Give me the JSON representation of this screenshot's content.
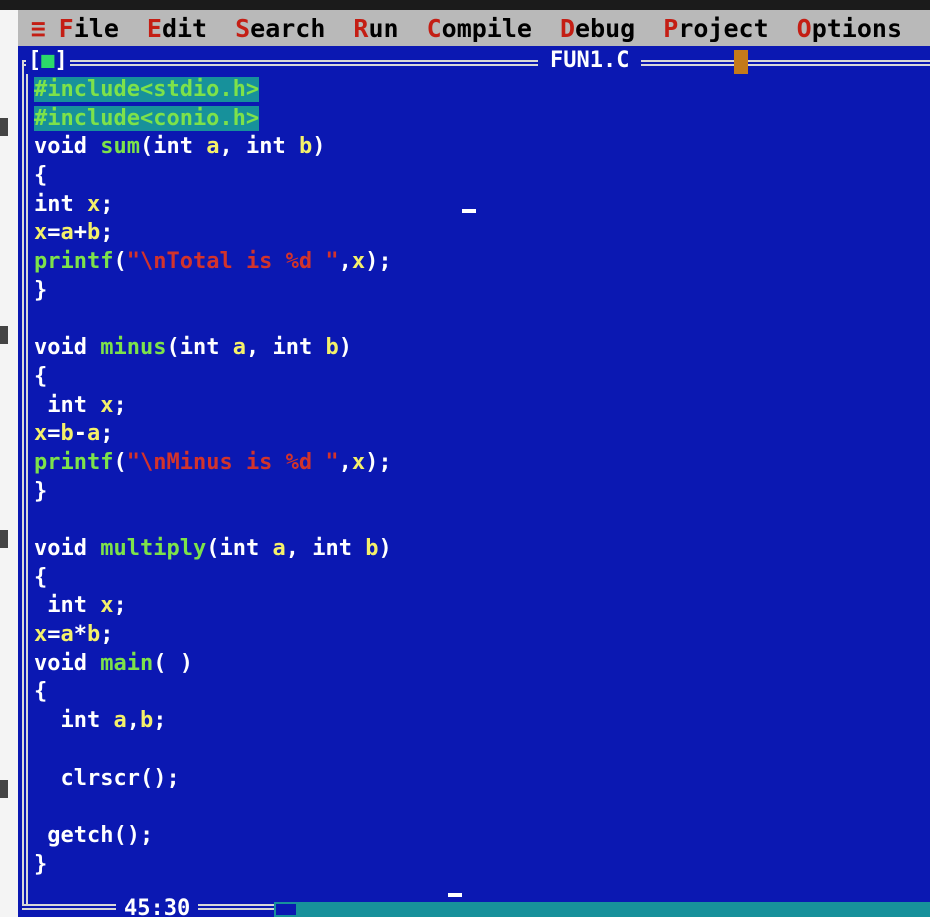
{
  "menu": {
    "system": "≡",
    "items": [
      {
        "hot": "F",
        "rest": "ile"
      },
      {
        "hot": "E",
        "rest": "dit"
      },
      {
        "hot": "S",
        "rest": "earch"
      },
      {
        "hot": "R",
        "rest": "un"
      },
      {
        "hot": "C",
        "rest": "ompile"
      },
      {
        "hot": "D",
        "rest": "ebug"
      },
      {
        "hot": "P",
        "rest": "roject"
      },
      {
        "hot": "O",
        "rest": "ptions"
      }
    ]
  },
  "window": {
    "close_box_left": "[",
    "close_box_mark": "■",
    "close_box_right": "]",
    "title": "FUN1.C"
  },
  "status": {
    "position": "45:30"
  },
  "code_lines": [
    "#include<stdio.h>",
    "#include<conio.h>",
    "void sum(int a, int b)",
    "{",
    "int x;",
    "x=a+b;",
    "printf(\"\\nTotal is %d \",x);",
    "}",
    "",
    "void minus(int a, int b)",
    "{",
    " int x;",
    "x=b-a;",
    "printf(\"\\nMinus is %d \",x);",
    "}",
    "",
    "void multiply(int a, int b)",
    "{",
    " int x;",
    "x=a*b;",
    "void main( )",
    "{",
    "  int a,b;",
    "",
    "  clrscr();",
    "",
    " getch();",
    "}"
  ],
  "colors": {
    "editor_bg": "#0b18b2",
    "menubar_bg": "#b9b9b9",
    "hotkey": "#c41e14",
    "keyword": "#ffffff",
    "identifier": "#f4f06a",
    "function": "#7de24a",
    "string": "#d2332c",
    "preprocessor_bg": "#17919b"
  }
}
